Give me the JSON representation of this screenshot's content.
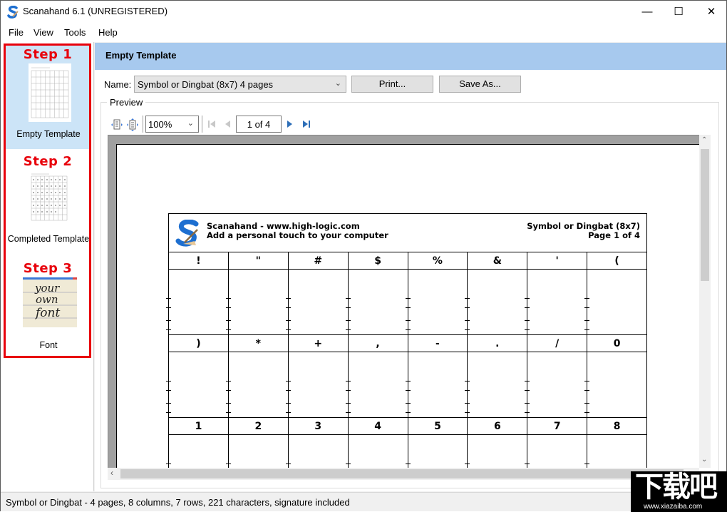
{
  "window": {
    "title": "Scanahand 6.1 (UNREGISTERED)",
    "controls": {
      "minimize": "—",
      "maximize": "☐",
      "close": "✕"
    }
  },
  "menu": [
    "File",
    "View",
    "Tools",
    "Help"
  ],
  "steps": [
    {
      "step_label": "Step 1",
      "caption": "Empty Template",
      "selected": true
    },
    {
      "step_label": "Step 2",
      "caption": "Completed Template",
      "selected": false
    },
    {
      "step_label": "Step 3",
      "caption": "Font",
      "selected": false,
      "thumb_words": [
        "your",
        "own",
        "font"
      ]
    }
  ],
  "content": {
    "header": "Empty Template",
    "name_label": "Name:",
    "name_value": "Symbol or Dingbat (8x7) 4 pages",
    "print_button": "Print...",
    "save_as_button": "Save As...",
    "preview_label": "Preview",
    "zoom_value": "100%",
    "page_indicator": "1 of 4"
  },
  "template": {
    "brand_line": "Scanahand - www.high-logic.com",
    "tagline": "Add a personal touch to your computer",
    "template_name": "Symbol or Dingbat (8x7)",
    "page_text": "Page 1 of 4",
    "rows": [
      [
        "!",
        "\"",
        "#",
        "$",
        "%",
        "&",
        "'",
        "("
      ],
      [
        ")",
        "*",
        "+",
        ",",
        "-",
        ".",
        "/",
        "0"
      ],
      [
        "1",
        "2",
        "3",
        "4",
        "5",
        "6",
        "7",
        "8"
      ]
    ]
  },
  "status": "Symbol or Dingbat - 4 pages, 8 columns, 7 rows, 221 characters, signature included",
  "watermark": {
    "big": "下载吧",
    "small": "www.xiazaiba.com"
  }
}
